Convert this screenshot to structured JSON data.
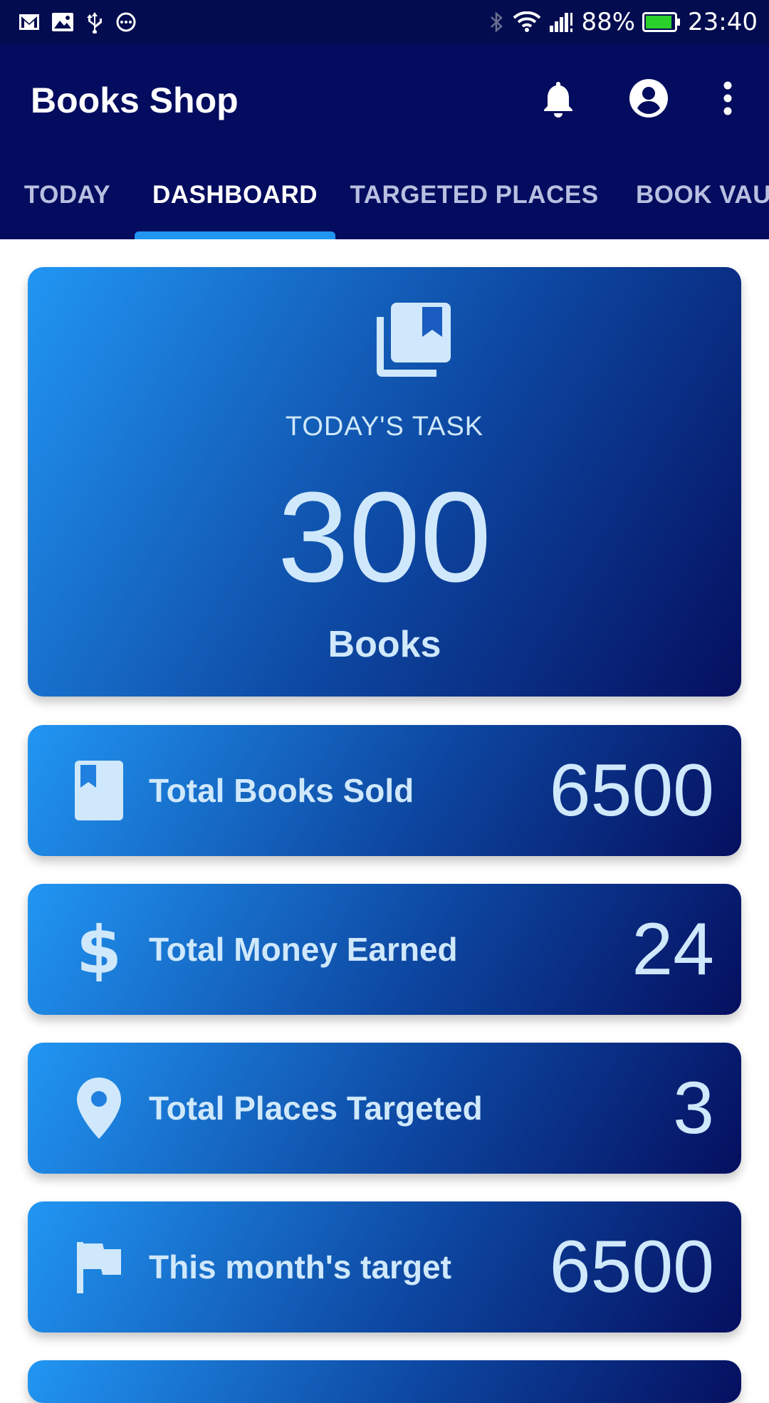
{
  "status_bar": {
    "battery": "88%",
    "time": "23:40",
    "left_icons": [
      "gmail-icon",
      "image-icon",
      "usb-icon",
      "more-circle-icon"
    ],
    "right_icons": [
      "bluetooth-icon",
      "wifi-icon",
      "signal-icon",
      "battery-icon"
    ]
  },
  "app_bar": {
    "title": "Books Shop",
    "actions": [
      "bell-icon",
      "account-circle-icon",
      "more-vert-icon"
    ]
  },
  "tabs": [
    {
      "label": "TODAY",
      "active": false
    },
    {
      "label": "DASHBOARD",
      "active": true
    },
    {
      "label": "TARGETED PLACES",
      "active": false
    },
    {
      "label": "BOOK VAULT",
      "active": false
    }
  ],
  "task_card": {
    "icon": "library-books-icon",
    "label": "TODAY'S TASK",
    "value": "300",
    "unit": "Books"
  },
  "stats": [
    {
      "icon": "book-icon",
      "label": "Total Books Sold",
      "value": "6500"
    },
    {
      "icon": "dollar-icon",
      "label": "Total Money Earned",
      "value": "24"
    },
    {
      "icon": "place-icon",
      "label": "Total Places Targeted",
      "value": "3"
    },
    {
      "icon": "flag-icon",
      "label": "This month's target",
      "value": "6500"
    }
  ],
  "colors": {
    "status_bar": "#030c4f",
    "app_bar": "#030c5e",
    "tab_indicator": "#2196f3",
    "card_gradient_start": "#2196f3",
    "card_gradient_end": "#050f5f",
    "card_text": "#cfe8fb"
  }
}
